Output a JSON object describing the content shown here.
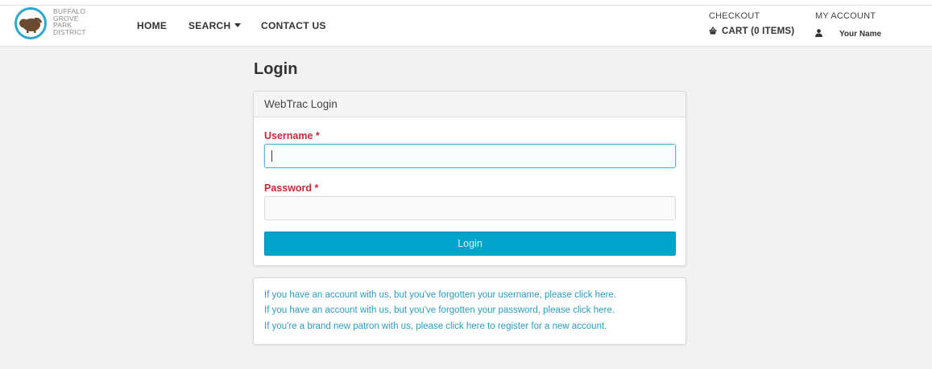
{
  "logo": {
    "lines": [
      "Buffalo",
      "Grove",
      "Park",
      "District"
    ]
  },
  "nav": {
    "home": "HOME",
    "search": "SEARCH",
    "contact": "CONTACT US"
  },
  "header_right": {
    "checkout_label": "CHECKOUT",
    "cart": "CART (0 ITEMS)",
    "my_account_label": "MY ACCOUNT",
    "account_name": "Your Name"
  },
  "page": {
    "title": "Login"
  },
  "login_panel": {
    "heading": "WebTrac Login",
    "username_label": "Username *",
    "username_value": "",
    "password_label": "Password *",
    "password_value": "",
    "login_button": "Login"
  },
  "help": {
    "forgot_username": "If you have an account with us, but you've forgotten your username, please click here.",
    "forgot_password": "If you have an account with us, but you've forgotten your password, please click here.",
    "register": "If you're a brand new patron with us, please click here to register for a new account."
  },
  "colors": {
    "accent": "#00a3c9",
    "link": "#2b9cc0",
    "required_label": "#c8283c",
    "logo_ring": "#2fa8cc",
    "logo_bison": "#6b4a2f"
  },
  "icons": {
    "logo": "bison-logo-icon",
    "cart": "basket-icon",
    "account": "user-icon",
    "search_dropdown": "caret-down-icon"
  }
}
